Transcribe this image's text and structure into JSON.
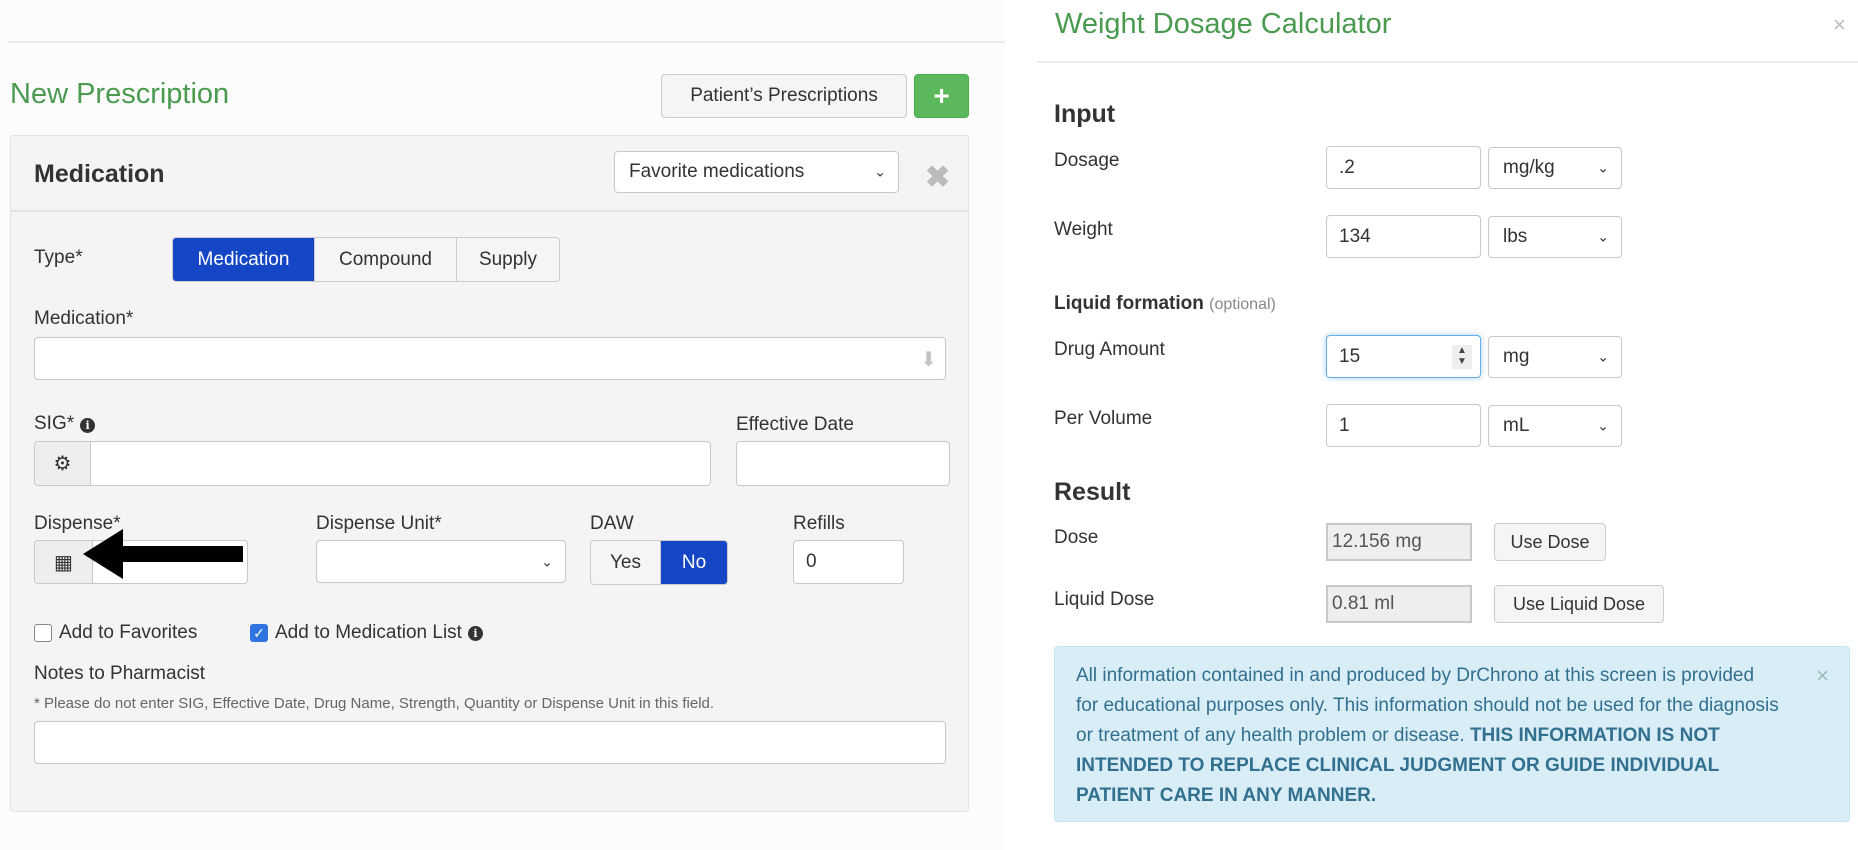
{
  "prescription": {
    "page_title": "New Prescription",
    "patient_prescriptions_label": "Patient’s Prescriptions",
    "add_label": "+",
    "panel_title": "Medication",
    "favorite_select_value": "Favorite medications",
    "type_label": "Type*",
    "type_options": [
      "Medication",
      "Compound",
      "Supply"
    ],
    "type_selected": "Medication",
    "medication_label": "Medication*",
    "medication_value": "",
    "sig_label": "SIG*",
    "sig_value": "",
    "effective_date_label": "Effective Date",
    "effective_date_value": "",
    "dispense_label": "Dispense*",
    "dispense_value": "",
    "dispense_unit_label": "Dispense Unit*",
    "dispense_unit_value": "",
    "daw_label": "DAW",
    "daw_options": [
      "Yes",
      "No"
    ],
    "daw_selected": "No",
    "refills_label": "Refills",
    "refills_value": "0",
    "add_to_favorites_label": "Add to Favorites",
    "add_to_favorites_checked": false,
    "add_to_med_list_label": "Add to Medication List",
    "add_to_med_list_checked": true,
    "notes_label": "Notes to Pharmacist",
    "notes_hint": "* Please do not enter SIG, Effective Date, Drug Name, Strength, Quantity or Dispense Unit in this field.",
    "notes_value": ""
  },
  "calculator": {
    "title": "Weight Dosage Calculator",
    "close": "×",
    "input_heading": "Input",
    "dosage_label": "Dosage",
    "dosage_value": ".2",
    "dosage_unit": "mg/kg",
    "weight_label": "Weight",
    "weight_value": "134",
    "weight_unit": "lbs",
    "liquid_heading": "Liquid formation",
    "liquid_optional": "(optional)",
    "drug_amount_label": "Drug Amount",
    "drug_amount_value": "15",
    "drug_amount_unit": "mg",
    "per_volume_label": "Per Volume",
    "per_volume_value": "1",
    "per_volume_unit": "mL",
    "result_heading": "Result",
    "dose_label": "Dose",
    "dose_value": "12.156 mg",
    "use_dose_label": "Use Dose",
    "liquid_dose_label": "Liquid Dose",
    "liquid_dose_value": "0.81 ml",
    "use_liquid_dose_label": "Use Liquid Dose",
    "disclaimer_text": "All information contained in and produced by DrChrono at this screen is provided for educational purposes only. This information should not be used for the diagnosis or treatment of any health problem or disease. ",
    "disclaimer_bold": "THIS INFORMATION IS NOT INTENDED TO REPLACE CLINICAL JUDGMENT OR GUIDE INDIVIDUAL PATIENT CARE IN ANY MANNER.",
    "disclaimer_close": "×"
  },
  "icons": {
    "gear": "⚙",
    "calculator": "▦",
    "down_arrow": "⬇",
    "info": "i",
    "close_x": "✖",
    "chevron": "⌄",
    "check": "✓"
  },
  "colors": {
    "accent_green": "#4a9a4f",
    "button_green": "#5cb85c",
    "active_blue": "#1546c6",
    "alert_bg": "#d9edf7",
    "alert_text": "#31708f"
  }
}
